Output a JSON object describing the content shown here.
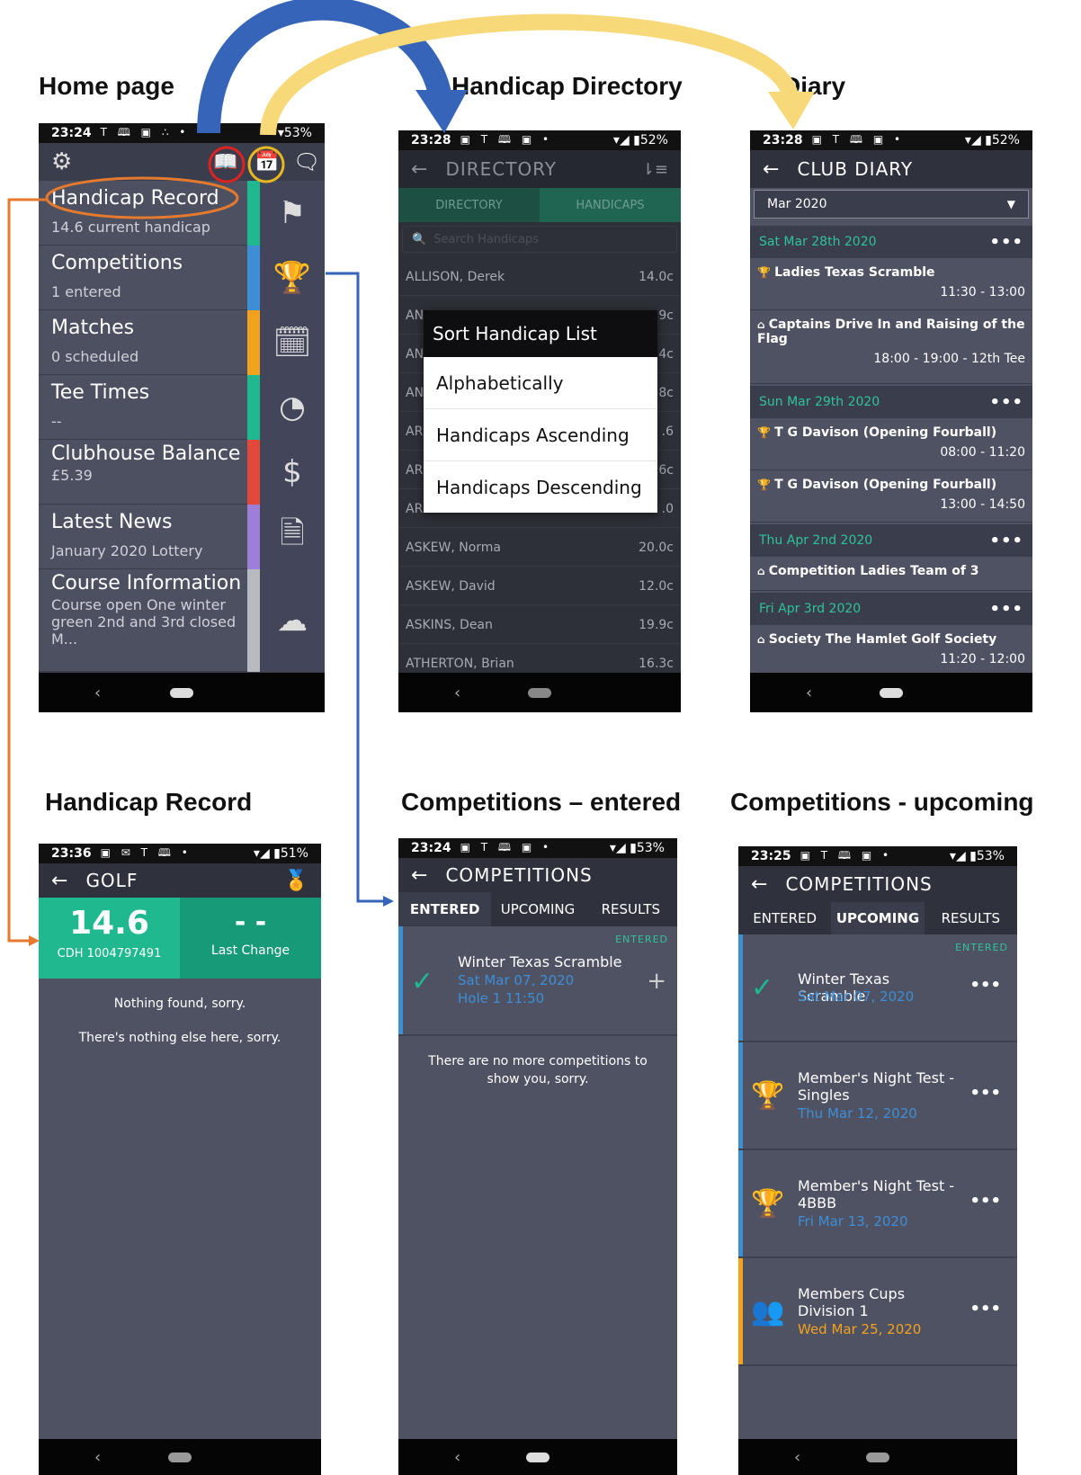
{
  "captions": {
    "home": "Home page",
    "directory": "Handicap Directory",
    "diary": "Diary",
    "record": "Handicap Record",
    "comp_entered": "Competitions – entered",
    "comp_upcoming": "Competitions - upcoming"
  },
  "colors": {
    "teal": "#1fb88f",
    "blue": "#3e8ed6",
    "orange": "#f2a21d",
    "red": "#e3493b",
    "purple": "#9d7fd9",
    "grey": "#b8bac0",
    "dark": "#2f313c"
  },
  "home": {
    "status_time": "23:24",
    "status_icons": "T 🕮 ▣ ∴ •",
    "status_right": "▾53%",
    "tiles": [
      {
        "title": "Handicap Record",
        "sub": "14.6 current handicap",
        "icon": "flag-icon"
      },
      {
        "title": "Competitions",
        "sub": "1 entered",
        "icon": "trophy-icon"
      },
      {
        "title": "Matches",
        "sub": "0 scheduled",
        "icon": "calendar-icon"
      },
      {
        "title": "Tee Times",
        "sub": "--",
        "icon": "clock-icon"
      },
      {
        "title": "Clubhouse Balance",
        "sub": "£5.39",
        "icon": "money-bag-icon"
      },
      {
        "title": "Latest News",
        "sub": "January 2020 Lottery",
        "icon": "document-icon"
      },
      {
        "title": "Course Information",
        "sub": "Course open One winter green 2nd and 3rd closed M...",
        "icon": "cloud-icon"
      }
    ]
  },
  "directory": {
    "status_time": "23:28",
    "status_right": "▾◢ ▮52%",
    "title": "DIRECTORY",
    "tabs": [
      "DIRECTORY",
      "HANDICAPS"
    ],
    "search_placeholder": "Search Handicaps",
    "rows": [
      {
        "name": "ALLISON, Derek",
        "hcp": "14.0c"
      },
      {
        "name": "AN",
        "hcp": "9c"
      },
      {
        "name": "AN",
        "hcp": "4c"
      },
      {
        "name": "AN",
        "hcp": "8c"
      },
      {
        "name": "AR",
        "hcp": ".6"
      },
      {
        "name": "AR",
        "hcp": "6c"
      },
      {
        "name": "AR",
        "hcp": ".0"
      },
      {
        "name": "ASKEW, Norma",
        "hcp": "20.0c"
      },
      {
        "name": "ASKEW, David",
        "hcp": "12.0c"
      },
      {
        "name": "ASKINS, Dean",
        "hcp": "19.9c"
      },
      {
        "name": "ATHERTON, Brian",
        "hcp": "16.3c"
      }
    ],
    "dialog": {
      "title": "Sort Handicap List",
      "options": [
        "Alphabetically",
        "Handicaps Ascending",
        "Handicaps Descending"
      ]
    }
  },
  "diary": {
    "status_time": "23:28",
    "status_right": "▾◢ ▮52%",
    "title": "CLUB DIARY",
    "month": "Mar 2020",
    "days": [
      {
        "date": "Sat Mar 28th 2020",
        "items": [
          {
            "name": "Ladies Texas Scramble",
            "time": "11:30 - 13:00",
            "icon": "trophy-icon"
          },
          {
            "name": "Captains Drive In and Raising of the Flag",
            "time": "18:00 - 19:00 - 12th Tee",
            "icon": "home-icon"
          }
        ]
      },
      {
        "date": "Sun Mar 29th 2020",
        "items": [
          {
            "name": "T G Davison (Opening Fourball)",
            "time": "08:00 - 11:20",
            "icon": "trophy-icon"
          },
          {
            "name": "T G Davison (Opening Fourball)",
            "time": "13:00 - 14:50",
            "icon": "trophy-icon"
          }
        ]
      },
      {
        "date": "Thu Apr 2nd 2020",
        "items": [
          {
            "name": "Competition Ladies Team of 3",
            "time": "",
            "icon": "home-icon"
          }
        ]
      },
      {
        "date": "Fri Apr 3rd 2020",
        "items": [
          {
            "name": "Society The Hamlet Golf Society",
            "time": "11:20 - 12:00",
            "icon": "home-icon"
          }
        ]
      }
    ]
  },
  "record": {
    "status_time": "23:36",
    "status_right": "▾◢ ▮51%",
    "title": "GOLF",
    "handicap": "14.6",
    "cdh": "CDH 1004797491",
    "last_change_value": "- -",
    "last_change_label": "Last Change",
    "msg1": "Nothing found, sorry.",
    "msg2": "There's nothing else here, sorry."
  },
  "comp_entered": {
    "status_time": "23:24",
    "status_right": "▾◢ ▮53%",
    "title": "COMPETITIONS",
    "tabs": [
      "ENTERED",
      "UPCOMING",
      "RESULTS"
    ],
    "item": {
      "badge": "ENTERED",
      "name": "Winter Texas Scramble",
      "date": "Sat Mar 07, 2020",
      "hole": "Hole 1 11:50"
    },
    "empty": "There are no more competitions to show you, sorry."
  },
  "comp_upcoming": {
    "status_time": "23:25",
    "status_right": "▾◢ ▮53%",
    "title": "COMPETITIONS",
    "tabs": [
      "ENTERED",
      "UPCOMING",
      "RESULTS"
    ],
    "items": [
      {
        "name": "Winter Texas Scramble",
        "date": "Sat Mar 07, 2020",
        "badge": "ENTERED"
      },
      {
        "name": "Member's Night Test - Singles",
        "date": "Thu Mar 12, 2020"
      },
      {
        "name": "Member's Night Test - 4BBB",
        "date": "Fri Mar 13, 2020"
      },
      {
        "name": "Members Cups Division 1",
        "date": "Wed Mar 25, 2020"
      }
    ]
  },
  "nav": {
    "back": "‹"
  }
}
